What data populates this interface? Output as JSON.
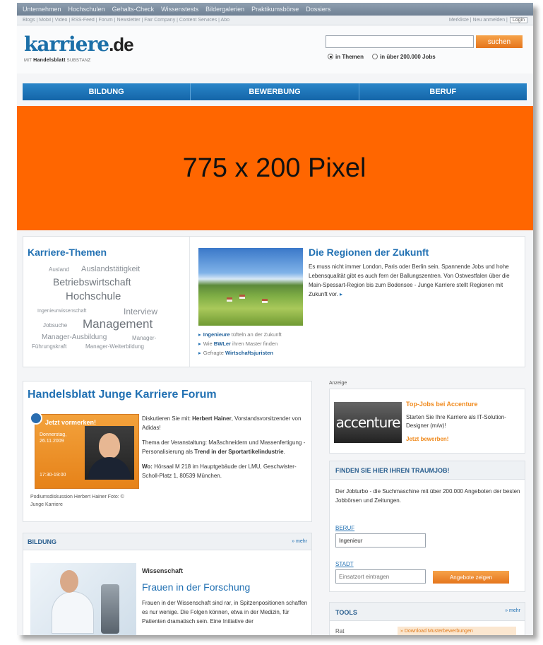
{
  "topnav": {
    "items": [
      "Unternehmen",
      "Hochschulen",
      "Gehalts-Check",
      "Wissenstests",
      "Bildergalerien",
      "Praktikumsbörse",
      "Dossiers"
    ]
  },
  "subnav": {
    "left": "Blogs | Mobil | Video | RSS-Feed | Forum | Newsletter | Fair Company | Content Services | Abo",
    "right": "Merkliste | Neu anmelden |",
    "login": "Login"
  },
  "header": {
    "logo_main": "karriere",
    "logo_tld": ".de",
    "logo_sub_prefix": "MIT",
    "logo_sub_brand": "Handelsblatt",
    "logo_sub_suffix": "SUBSTANZ"
  },
  "search": {
    "value": "",
    "button": "suchen",
    "option1": "in Themen",
    "option2": "in über 200.000 Jobs"
  },
  "mainnav": {
    "tabs": [
      "BILDUNG",
      "BEWERBUNG",
      "BERUF"
    ]
  },
  "banner": {
    "text": "775 x 200 Pixel",
    "color": "#ff6600"
  },
  "themes": {
    "title": "Karriere-Themen",
    "tags": [
      "Ausland",
      "Auslandstätigkeit",
      "Betriebswirtschaft",
      "Hochschule",
      "Ingenieurwissenschaft",
      "Interview",
      "Jobsuche",
      "Management",
      "Manager-Ausbildung",
      "Manager-",
      "Führungskraft",
      "Manager-Weiterbildung"
    ]
  },
  "regions": {
    "title": "Die Regionen der Zukunft",
    "text": "Es muss nicht immer London, Paris oder Berlin sein. Spannende Jobs und hohe Lebensqualität gibt es auch fern der Ballungszentren. Von Ostwestfalen über die Main-Spessart-Region bis zum Bodensee - Junge Karriere stellt Regionen mit Zukunft vor.",
    "links": [
      {
        "bold": "Ingenieure",
        "rest": " tüfteln an der Zukunft"
      },
      {
        "pre": "Wie ",
        "bold": "BWLer",
        "rest": " ihren Master finden"
      },
      {
        "pre": "Gefragte ",
        "bold": "Wirtschaftsjuristen",
        "rest": ""
      }
    ]
  },
  "forum": {
    "title": "Handelsblatt Junge Karriere Forum",
    "card_tag": "Jetzt vormerken!",
    "card_date1": "Donnerstag,",
    "card_date2": "26.11.2009",
    "card_time": "17:30-19:00",
    "caption": "Podiumsdiskussion Herbert Hainer Foto: © Junge Karriere",
    "p1_pre": "Diskutieren Sie mit: ",
    "p1_bold": "Herbert Hainer",
    "p1_post": ", Vorstandsvorsitzender von Adidas!",
    "p2_pre": "Thema der Veranstaltung: Maßschneidern und Massenfertigung - Personalisierung als ",
    "p2_bold": "Trend in der Sportartikelindustrie",
    "p2_post": ".",
    "p3_bold": "Wo:",
    "p3_rest": " Hörsaal M 218 im Hauptgebäude der LMU, Geschwister-Scholl-Platz 1, 80539 München."
  },
  "bildung": {
    "header": "BILDUNG",
    "more": "» mehr",
    "category": "Wissenschaft",
    "title": "Frauen in der Forschung",
    "text": "Frauen in der Wissenschaft sind rar, in Spitzenpositionen schaffen es nur wenige. Die Folgen können, etwa in der Medizin, für Patienten dramatisch sein. Eine Initiative der"
  },
  "ad": {
    "label": "Anzeige",
    "logo": "accenture",
    "title": "Top-Jobs bei Accenture",
    "text": "Starten Sie Ihre Karriere als IT-Solution-Designer (m/w)!",
    "cta": "Jetzt bewerben!"
  },
  "jobsearch": {
    "header": "FINDEN SIE HIER IHREN TRAUMJOB!",
    "text": "Der Jobturbo - die Suchmaschine mit über 200.000 Angeboten der besten Jobbörsen und Zeitungen.",
    "beruf_label": "BERUF",
    "beruf_value": "Ingenieur",
    "stadt_label": "STADT",
    "stadt_value": "Einsatzort eintragen",
    "button": "Angebote zeigen"
  },
  "tools": {
    "header": "TOOLS",
    "more": "» mehr",
    "row_label": "Rat",
    "link": "» Download Musterbewerbungen"
  }
}
